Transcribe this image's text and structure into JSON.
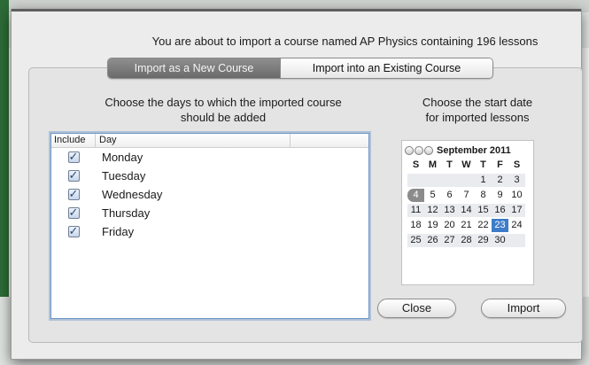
{
  "message": "You are about to import a course named AP Physics containing 196 lessons",
  "tabs": [
    {
      "label": "Import as a New Course",
      "active": true
    },
    {
      "label": "Import into an Existing Course",
      "active": false
    }
  ],
  "days_instruction_line1": "Choose the days to which the imported course",
  "days_instruction_line2": "should be added",
  "start_instruction_line1": "Choose the start date",
  "start_instruction_line2": "for imported lessons",
  "table": {
    "headers": {
      "include": "Include",
      "day": "Day"
    },
    "rows": [
      {
        "day": "Monday",
        "checked": true
      },
      {
        "day": "Tuesday",
        "checked": true
      },
      {
        "day": "Wednesday",
        "checked": true
      },
      {
        "day": "Thursday",
        "checked": true
      },
      {
        "day": "Friday",
        "checked": true
      }
    ]
  },
  "calendar": {
    "month_label": "September 2011",
    "weekdays": [
      "S",
      "M",
      "T",
      "W",
      "T",
      "F",
      "S"
    ],
    "weeks": [
      [
        "",
        "",
        "",
        "",
        "1",
        "2",
        "3"
      ],
      [
        "4",
        "5",
        "6",
        "7",
        "8",
        "9",
        "10"
      ],
      [
        "11",
        "12",
        "13",
        "14",
        "15",
        "16",
        "17"
      ],
      [
        "18",
        "19",
        "20",
        "21",
        "22",
        "23",
        "24"
      ],
      [
        "25",
        "26",
        "27",
        "28",
        "29",
        "30",
        ""
      ]
    ],
    "today": "4",
    "selected": "23"
  },
  "buttons": {
    "close": "Close",
    "import": "Import"
  },
  "colors": {
    "selected_day": "#3d7cc8",
    "active_tab": "#7a7a7a",
    "focus_ring": "#6e96c6"
  }
}
